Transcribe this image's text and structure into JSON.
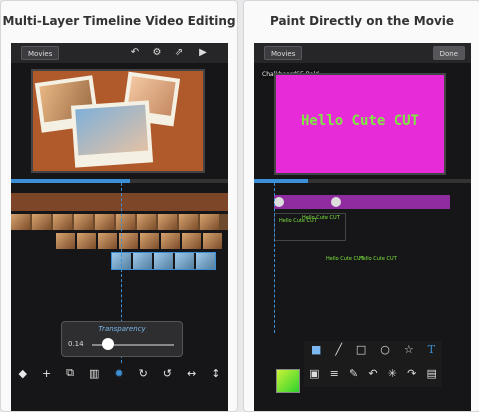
{
  "left_panel": {
    "caption": "Multi-Layer Timeline Video Editing",
    "movies_button": "Movies",
    "transparency_label": "Transparency",
    "transparency_value": "0.14",
    "transparency_fraction": 0.2,
    "top_icons": [
      "undo-icon",
      "gear-icon",
      "share-icon",
      "play-icon"
    ],
    "bottom_tools": [
      "◆",
      "+",
      "⧉",
      "🗑",
      "✹",
      "↻",
      "↺",
      "↔",
      "↕"
    ],
    "bottom_tool_names": [
      "arrow-left-icon",
      "add-icon",
      "copy-icon",
      "trash-icon",
      "brightness-icon",
      "redo-icon",
      "rotate-icon",
      "stretch-horizontal-icon",
      "stretch-vertical-icon"
    ]
  },
  "right_panel": {
    "caption": "Paint Directly on the Movie",
    "movies_button": "Movies",
    "done_button": "Done",
    "font_name": "ChalkboardSE-Bold",
    "canvas_text": "Hello Cute CUT",
    "canvas_color": "#e82bd8",
    "text_color": "#7ee840",
    "clip_labels": [
      "Hello Cute CUT",
      "Hello Cute CUT",
      "Hello Cute CUT",
      "Hello Cute CUT"
    ],
    "tools_row1": [
      "■",
      "╱",
      "□",
      "○",
      "☆",
      "T"
    ],
    "tools_row2": [
      "▣",
      "≡",
      "✎",
      "↶",
      "✳",
      "↷",
      "▤"
    ],
    "tools_row1_names": [
      "fill-rect-icon",
      "line-icon",
      "rectangle-icon",
      "ellipse-icon",
      "star-icon",
      "text-icon"
    ],
    "tools_row2_names": [
      "image-icon",
      "lines-icon",
      "brush-icon",
      "undo-icon",
      "sparkle-icon",
      "redo-icon",
      "save-icon"
    ]
  }
}
